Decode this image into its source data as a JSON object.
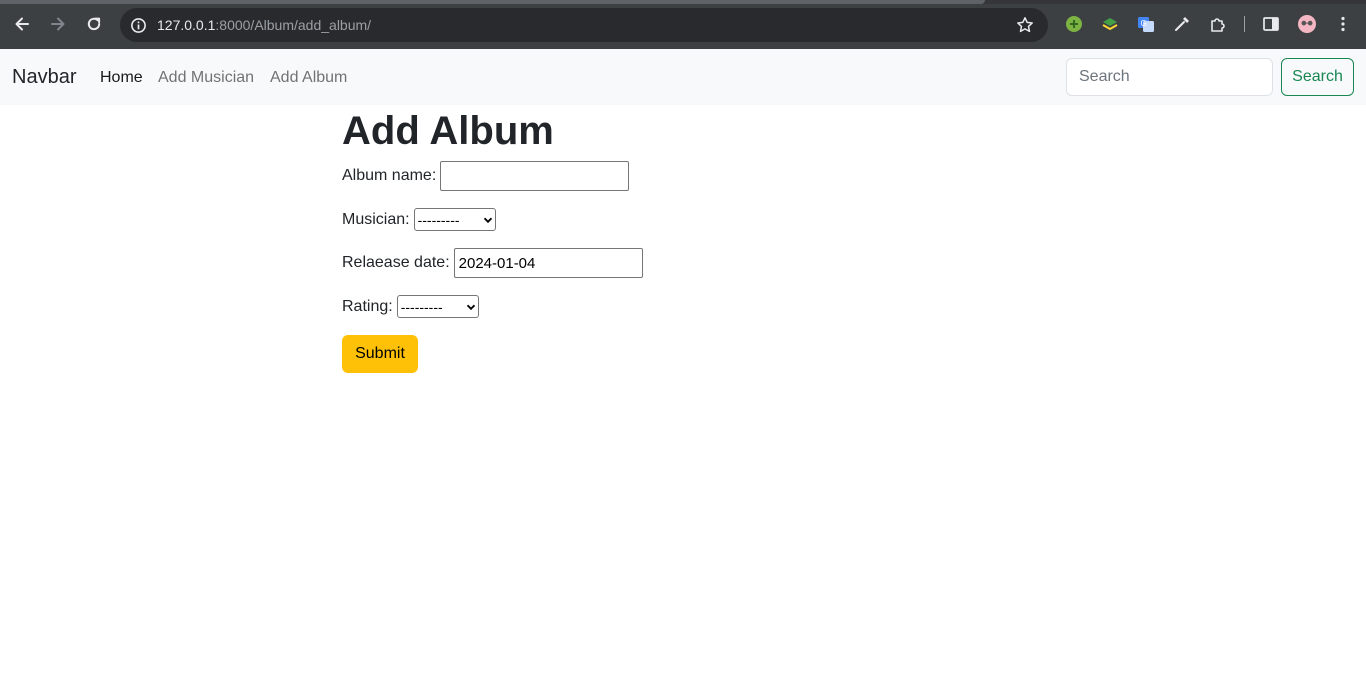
{
  "browser": {
    "url_host": "127.0.0.1",
    "url_path": ":8000/Album/add_album/"
  },
  "navbar": {
    "brand": "Navbar",
    "links": [
      {
        "label": "Home",
        "active": true
      },
      {
        "label": "Add Musician",
        "active": false
      },
      {
        "label": "Add Album",
        "active": false
      }
    ],
    "search_placeholder": "Search",
    "search_button": "Search",
    "search_button_color": "#198754"
  },
  "form": {
    "title": "Add Album",
    "album_name_label": "Album name:",
    "album_name_value": "",
    "musician_label": "Musician:",
    "musician_selected": "---------",
    "release_date_label": "Relaease date:",
    "release_date_value": "2024-01-04",
    "rating_label": "Rating:",
    "rating_selected": "---------",
    "submit_label": "Submit",
    "submit_color": "#ffc107"
  }
}
